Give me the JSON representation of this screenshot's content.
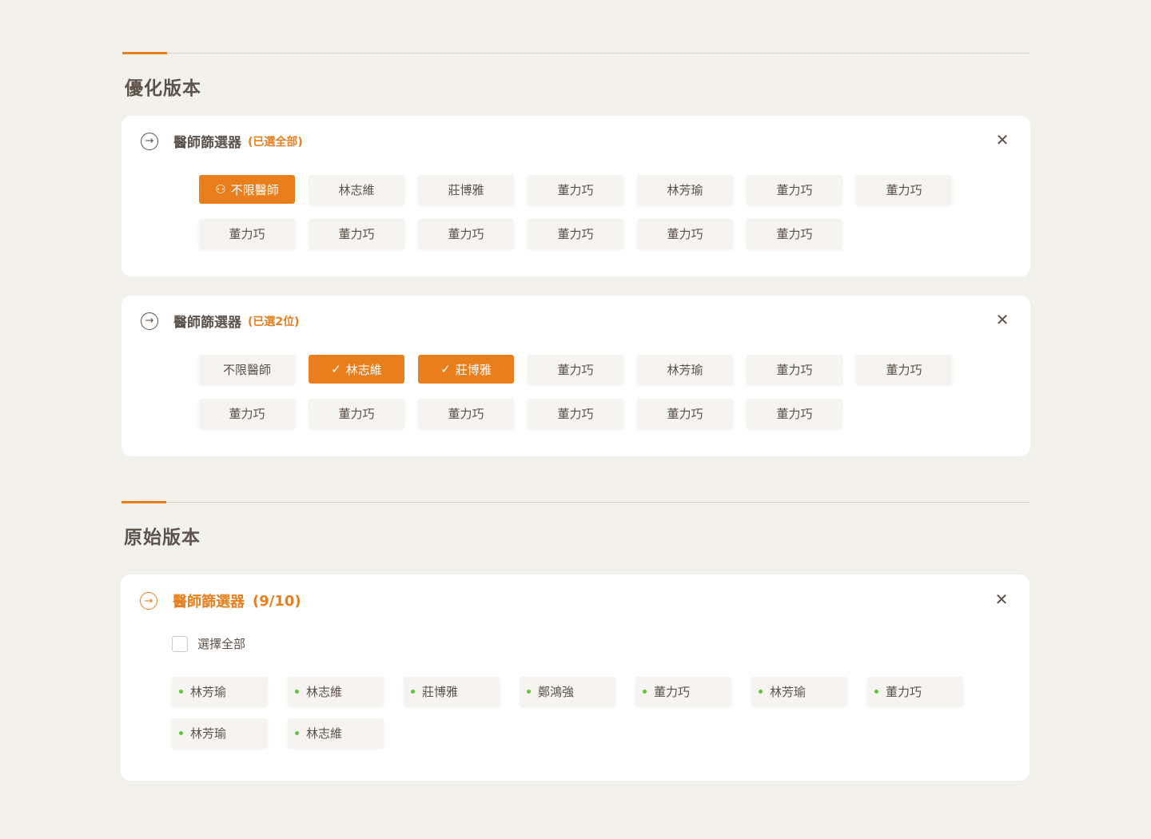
{
  "colors": {
    "accent": "#e87f1c",
    "background": "#f3f1ec",
    "text": "#5b5048",
    "dot": "#5fc23a"
  },
  "sections": [
    {
      "title": "優化版本"
    },
    {
      "title": "原始版本"
    }
  ],
  "cards": [
    {
      "icon": "arrow-right-circle-icon",
      "title": "醫師篩選器",
      "count": "(已選全部)",
      "chips": [
        {
          "label": "不限醫師",
          "active": true,
          "icon": "users-icon"
        },
        {
          "label": "林志維",
          "active": false
        },
        {
          "label": "莊博雅",
          "active": false
        },
        {
          "label": "董力巧",
          "active": false
        },
        {
          "label": "林芳瑜",
          "active": false
        },
        {
          "label": "董力巧",
          "active": false
        },
        {
          "label": "董力巧",
          "active": false
        },
        {
          "label": "董力巧",
          "active": false
        },
        {
          "label": "董力巧",
          "active": false
        },
        {
          "label": "董力巧",
          "active": false
        },
        {
          "label": "董力巧",
          "active": false
        },
        {
          "label": "董力巧",
          "active": false
        },
        {
          "label": "董力巧",
          "active": false
        }
      ]
    },
    {
      "icon": "arrow-right-circle-icon",
      "title": "醫師篩選器",
      "count": "(已選2位)",
      "chips": [
        {
          "label": "不限醫師",
          "active": false
        },
        {
          "label": "林志維",
          "active": true,
          "icon": "check-icon"
        },
        {
          "label": "莊博雅",
          "active": true,
          "icon": "check-icon"
        },
        {
          "label": "董力巧",
          "active": false
        },
        {
          "label": "林芳瑜",
          "active": false
        },
        {
          "label": "董力巧",
          "active": false
        },
        {
          "label": "董力巧",
          "active": false
        },
        {
          "label": "董力巧",
          "active": false
        },
        {
          "label": "董力巧",
          "active": false
        },
        {
          "label": "董力巧",
          "active": false
        },
        {
          "label": "董力巧",
          "active": false
        },
        {
          "label": "董力巧",
          "active": false
        },
        {
          "label": "董力巧",
          "active": false
        }
      ]
    },
    {
      "icon": "arrow-right-circle-icon",
      "title": "醫師篩選器",
      "count": "(9/10)",
      "select_all_label": "選擇全部",
      "select_all_checked": false,
      "tags": [
        "林芳瑜",
        "林志維",
        "莊博雅",
        "鄭鴻強",
        "董力巧",
        "林芳瑜",
        "董力巧",
        "林芳瑜",
        "林志維"
      ]
    }
  ]
}
